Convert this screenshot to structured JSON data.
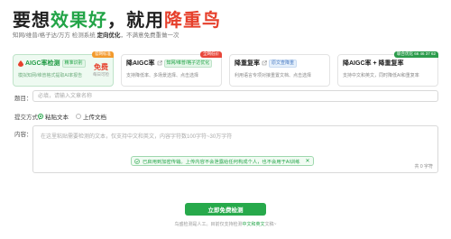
{
  "hero": {
    "title_pre": "要想",
    "title_green": "效果好",
    "title_mid": "，就用",
    "title_red": "降重鸟",
    "subtitle_pre": "知网/维普/格子达/万方 检测系统 ",
    "subtitle_strong": "定向优化",
    "subtitle_post": "，不满意免费重做一次"
  },
  "cards": [
    {
      "title": "AIGC率检测",
      "tag": "精准识别",
      "desc": "模拟知网/维普格式提取AI率报告",
      "corner": "官网标准",
      "free_big": "免费",
      "free_small": "每日可检"
    },
    {
      "title": "降AIGC率",
      "tag": "知网/维普/格子达优化",
      "desc": "支持降低率、多场景选择、点击选择",
      "corner": "全网低价"
    },
    {
      "title": "降重复率",
      "tag": "原文查降重",
      "desc": "利用语言专项对接重置文档、点击选择"
    },
    {
      "title": "降AIGC率 + 降重复率",
      "desc": "支持中文和英文，同时降低AI和重复率",
      "corner": "联合优化 66 46 37 62"
    }
  ],
  "form": {
    "title_label": "题目：",
    "title_placeholder": "必填，请输入文章名称",
    "method_label": "提交方式：",
    "method_options": [
      "粘贴文本",
      "上传文档"
    ],
    "method_selected": "粘贴文本",
    "content_label": "内容：",
    "content_placeholder": "在这里粘贴需要检测的文本，仅支持中文和英文，内容字符数100字符~30万字符",
    "notice": "已启用到加密传输。上传内容不会泄露给任何构成个人，也不会用于AI训练",
    "notice_close": "✕",
    "word_count": "共 0 字符"
  },
  "submit_label": "立即免费检测",
  "footer": {
    "pre": "鸟盛检测是人工。目前仅支持检测",
    "link": "中文和英文",
    "post": "文稿~"
  },
  "colors": {
    "brand_green": "#22a447",
    "brand_red": "#e6402c",
    "button_green": "#27a94b"
  }
}
